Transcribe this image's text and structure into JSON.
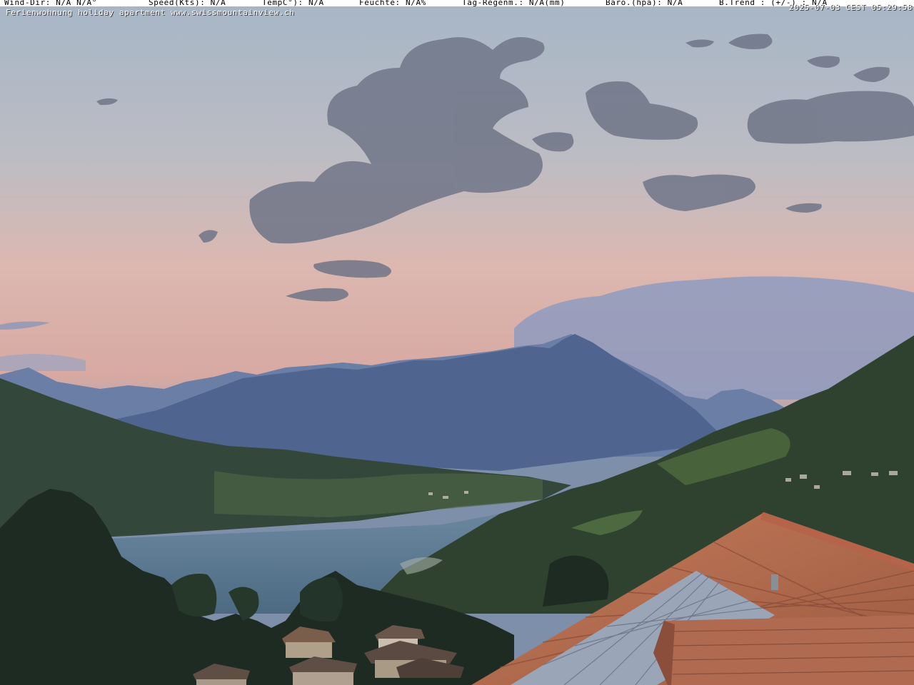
{
  "overlay": {
    "wind_dir": "Wind-Dir: N/A  N/A°",
    "speed": "Speed(Kts):   N/A",
    "temp": "TempC°):   N/A",
    "humidity": "Feuchte:   N/A%",
    "rain": "Tag-Regenm.:   N/A(mm)",
    "baro": "Baro.(hpa):   N/A",
    "trend": "B.Trend  : (+/-) : N/A",
    "caption": "Ferienwohnung holiday apartment www.swissmountainview.ch",
    "timestamp": "2025-07-03 CEST 05:29:58"
  },
  "colors": {
    "sky_top": "#a9b9c9",
    "sky_mid": "#c4b8bb",
    "sky_horizon": "#e6b6a4",
    "clouds": "#6f7488",
    "mountains_far": "#6478a0",
    "mountains_near": "#465a82",
    "lake": "#5c7a95",
    "hills": "#2e4230",
    "roof": "#b26a4d",
    "solar_panel": "#9ba7b9"
  }
}
